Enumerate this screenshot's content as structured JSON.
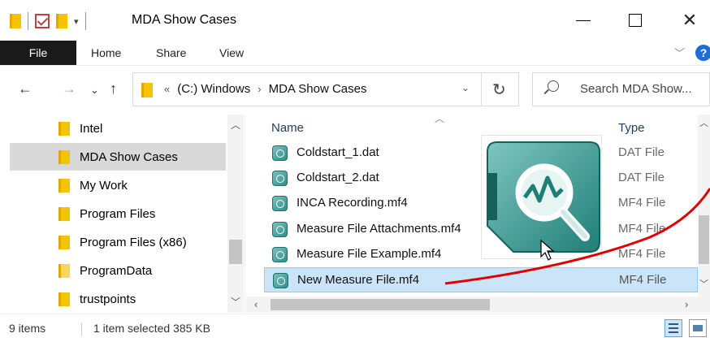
{
  "window": {
    "title": "MDA Show Cases",
    "min_icon": "minimize-icon",
    "max_icon": "maximize-icon",
    "close_glyph": "✕"
  },
  "ribbon": {
    "file_label": "File",
    "tabs": [
      "Home",
      "Share",
      "View"
    ],
    "help_label": "?"
  },
  "nav": {
    "back": "←",
    "forward": "→",
    "recent": "⌄",
    "up": "↑",
    "address": {
      "overflow": "«",
      "crumbs": [
        "(C:) Windows",
        "MDA Show Cases"
      ],
      "separator": "›"
    },
    "refresh": "↻",
    "search_placeholder": "Search MDA Show..."
  },
  "sidebar": {
    "items": [
      {
        "label": "Intel",
        "selected": false
      },
      {
        "label": "MDA Show Cases",
        "selected": true
      },
      {
        "label": "My Work",
        "selected": false
      },
      {
        "label": "Program Files",
        "selected": false
      },
      {
        "label": "Program Files (x86)",
        "selected": false
      },
      {
        "label": "ProgramData",
        "selected": false
      },
      {
        "label": "trustpoints",
        "selected": false
      }
    ]
  },
  "content": {
    "columns": {
      "name": "Name",
      "type": "Type"
    },
    "files": [
      {
        "name": "Coldstart_1.dat",
        "type": "DAT File",
        "selected": false
      },
      {
        "name": "Coldstart_2.dat",
        "type": "DAT File",
        "selected": false
      },
      {
        "name": "INCA Recording.mf4",
        "type": "MF4 File",
        "selected": false
      },
      {
        "name": "Measure File Attachments.mf4",
        "type": "MF4 File",
        "selected": false
      },
      {
        "name": "Measure File Example.mf4",
        "type": "MF4 File",
        "selected": false
      },
      {
        "name": "New Measure File.mf4",
        "type": "MF4 File",
        "selected": true
      }
    ]
  },
  "status": {
    "count": "9 items",
    "selection": "1 item selected  385 KB"
  },
  "colors": {
    "selection_bg": "#cce4f7",
    "sidebar_selected_bg": "#d9d9d9",
    "annotation_line": "#e00000",
    "app_tile": "#2e8f8a"
  }
}
